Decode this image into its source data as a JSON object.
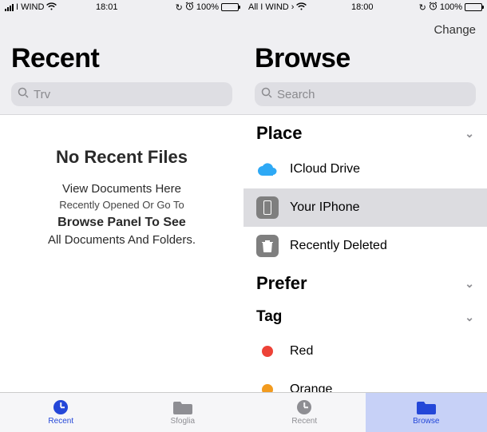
{
  "status": {
    "carrier_left": "I WIND",
    "time_left": "18:01",
    "battery_left": "100%",
    "carrier_right": "All I WIND",
    "time_right": "18:00",
    "battery_right": "100%"
  },
  "left": {
    "title": "Recent",
    "search_placeholder": "Trv",
    "empty": {
      "title": "No Recent Files",
      "line1": "View Documents Here",
      "line2": "Recently Opened Or Go To",
      "line3": "Browse Panel To See",
      "line4": "All Documents And Folders."
    }
  },
  "right": {
    "change_label": "Change",
    "title": "Browse",
    "search_placeholder": "Search",
    "sections": {
      "place_header": "Place",
      "prefer_header": "Prefer",
      "tag_header": "Tag"
    },
    "places": {
      "icloud": "ICloud Drive",
      "device": "Your IPhone",
      "deleted": "Recently Deleted"
    },
    "tags": {
      "red": {
        "label": "Red",
        "color": "#ed4237"
      },
      "orange": {
        "label": "Orange",
        "color": "#f29b1f"
      }
    }
  },
  "tabs": {
    "recent_a": "Recent",
    "sfoglia": "Sfoglia",
    "recent_b": "Recent",
    "browse": "Browse"
  },
  "colors": {
    "accent": "#2447d8",
    "active_bg": "#c7d1f7",
    "grey_bg": "#efeff2"
  }
}
